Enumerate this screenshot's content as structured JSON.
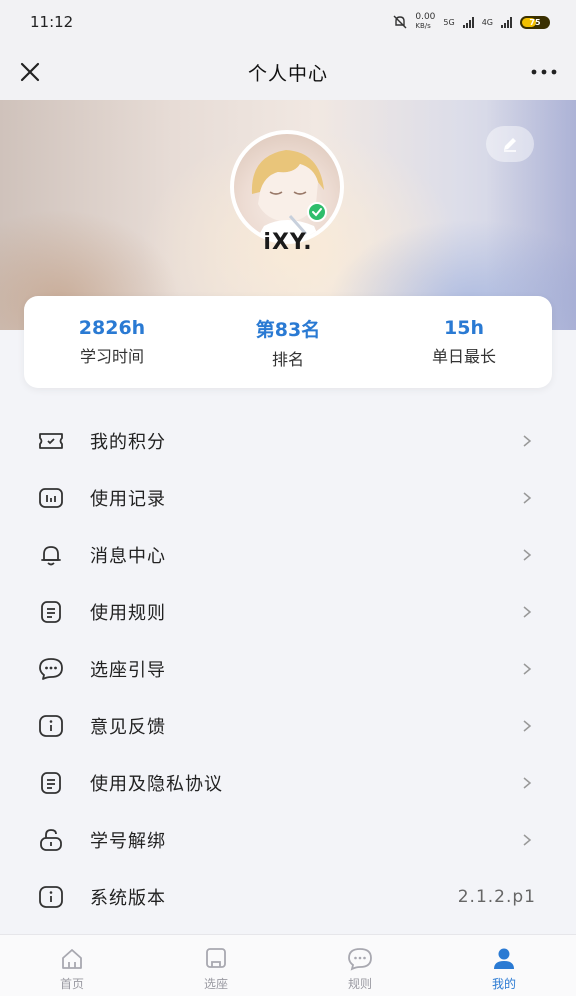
{
  "status_bar": {
    "time": "11:12",
    "speed": "0.00",
    "speed_unit": "KB/s",
    "network_1": "5G",
    "network_2": "4G",
    "battery": "75"
  },
  "nav": {
    "title": "个人中心"
  },
  "profile": {
    "username": "iXY.",
    "verified": true
  },
  "stats": [
    {
      "value": "2826h",
      "label": "学习时间"
    },
    {
      "value": "第83名",
      "label": "排名"
    },
    {
      "value": "15h",
      "label": "单日最长"
    }
  ],
  "menu": [
    {
      "label": "我的积分",
      "icon": "ticket-icon"
    },
    {
      "label": "使用记录",
      "icon": "chart-record-icon"
    },
    {
      "label": "消息中心",
      "icon": "bell-icon"
    },
    {
      "label": "使用规则",
      "icon": "document-icon"
    },
    {
      "label": "选座引导",
      "icon": "chat-bubble-icon"
    },
    {
      "label": "意见反馈",
      "icon": "info-icon"
    },
    {
      "label": "使用及隐私协议",
      "icon": "agreement-icon"
    },
    {
      "label": "学号解绑",
      "icon": "unlock-icon"
    },
    {
      "label": "系统版本",
      "icon": "info-icon",
      "value": "2.1.2.p1"
    }
  ],
  "tabs": [
    {
      "label": "首页",
      "icon": "home-icon",
      "active": false
    },
    {
      "label": "选座",
      "icon": "seat-icon",
      "active": false
    },
    {
      "label": "规则",
      "icon": "rules-icon",
      "active": false
    },
    {
      "label": "我的",
      "icon": "person-icon",
      "active": true
    }
  ],
  "colors": {
    "accent": "#2a7ad3",
    "verified": "#2ebd6b",
    "battery": "#f2c000"
  }
}
